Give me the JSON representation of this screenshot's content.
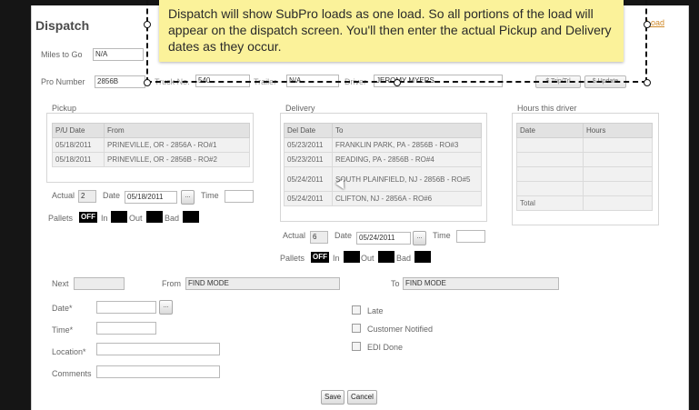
{
  "header": {
    "title": "Dispatch",
    "load_link": "Load"
  },
  "tooltip": {
    "text": "Dispatch will show SubPro loads as one load. So all portions of the load will appear on the dispatch screen. You'll then enter the actual Pickup and Delivery dates as they occur."
  },
  "top": {
    "miles_label": "Miles to Go",
    "miles_value": "N/A",
    "pro_label": "Pro Number",
    "pro_value": "2856B",
    "truck_label": "Truck No.",
    "truck_value": "540",
    "trailer_label": "Trailer",
    "trailer_value": "N/A",
    "driver_label": "Driver",
    "driver_value": "JEROMY MYERS",
    "btn_trip": "$ Trip/Trl",
    "btn_update": "$ Update"
  },
  "pickup": {
    "legend": "Pickup",
    "columns": [
      "P/U Date",
      "From"
    ],
    "rows": [
      [
        "05/18/2011",
        "PRINEVILLE, OR - 2856A - RO#1"
      ],
      [
        "05/18/2011",
        "PRINEVILLE, OR - 2856B - RO#2"
      ]
    ],
    "actual_label": "Actual",
    "actual_value": "2",
    "date_label": "Date",
    "date_value": "05/18/2011",
    "time_label": "Time",
    "time_value": "",
    "pallets_label": "Pallets",
    "toggle": "OFF",
    "in_label": "In",
    "out_label": "Out",
    "bad_label": "Bad"
  },
  "delivery": {
    "legend": "Delivery",
    "columns": [
      "Del Date",
      "To"
    ],
    "rows": [
      [
        "05/23/2011",
        "FRANKLIN PARK, PA - 2856B - RO#3"
      ],
      [
        "05/23/2011",
        "READING, PA - 2856B - RO#4"
      ],
      [
        "05/24/2011",
        "SOUTH PLAINFIELD, NJ - 2856B - RO#5"
      ],
      [
        "05/24/2011",
        "CLIFTON, NJ - 2856A - RO#6"
      ]
    ],
    "actual_label": "Actual",
    "actual_value": "6",
    "date_label": "Date",
    "date_value": "05/24/2011",
    "time_label": "Time",
    "time_value": "",
    "pallets_label": "Pallets",
    "toggle": "OFF",
    "in_label": "In",
    "out_label": "Out",
    "bad_label": "Bad"
  },
  "hours": {
    "legend": "Hours this driver",
    "columns": [
      "Date",
      "Hours"
    ],
    "total_label": "Total"
  },
  "next": {
    "next_label": "Next",
    "next_value": "",
    "from_label": "From",
    "from_value": "FIND MODE",
    "to_label": "To",
    "to_value": "FIND MODE",
    "date_label": "Date*",
    "time_label": "Time*",
    "location_label": "Location*",
    "comments_label": "Comments",
    "late_label": "Late",
    "notified_label": "Customer Notified",
    "edi_label": "EDI Done",
    "save": "Save",
    "cancel": "Cancel"
  },
  "colors": {
    "tooltip_bg": "#fbf29a",
    "link": "#d08a2a",
    "toggle_bg": "#000000"
  },
  "icons": {
    "calendar": "ellipsis-calendar-icon",
    "cursor": "mouse-pointer-icon"
  }
}
